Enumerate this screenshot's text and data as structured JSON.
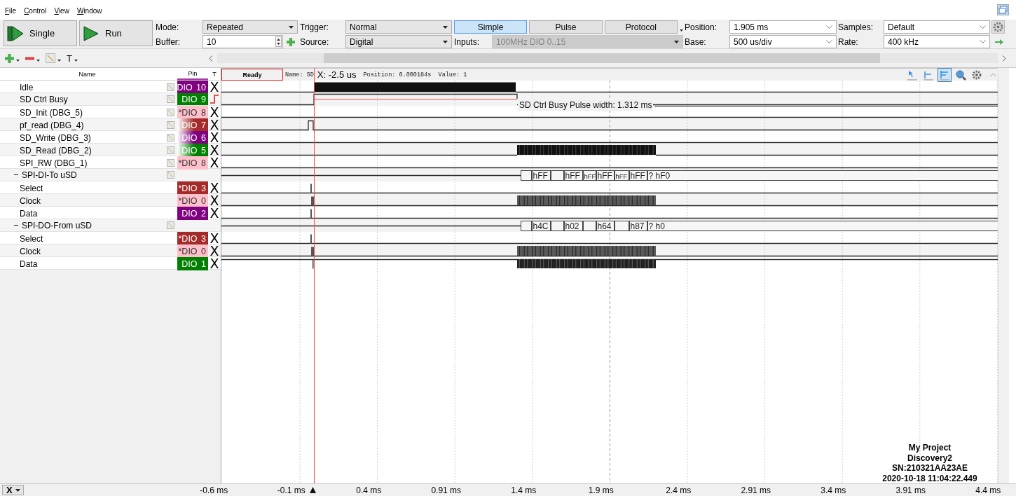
{
  "menu": [
    {
      "label": "File"
    },
    {
      "label": "Control"
    },
    {
      "label": "View"
    },
    {
      "label": "Window"
    }
  ],
  "toolbar": {
    "single": "Single",
    "run": "Run",
    "mode_label": "Mode:",
    "mode": "Repeated",
    "buffer_label": "Buffer:",
    "buffer": "10",
    "trigger_label": "Trigger:",
    "trigger": "Normal",
    "source_label": "Source:",
    "source": "Digital",
    "trigger_tabs": [
      {
        "label": "Simple",
        "selected": true
      },
      {
        "label": "Pulse",
        "selected": false
      },
      {
        "label": "Protocol",
        "selected": false
      }
    ],
    "inputs_label": "Inputs:",
    "inputs": {
      "value": "100MHz DIO 0..15",
      "disabled": true
    },
    "position_label": "Position:",
    "position": "1.905 ms",
    "base_label": "Base:",
    "base": "500 us/div",
    "samples_label": "Samples:",
    "samples": "Default",
    "rate_label": "Rate:",
    "rate": "400 kHz"
  },
  "edit_toolbar": {
    "text_tool": "T"
  },
  "list_header": {
    "name": "Name",
    "pin": "Pin",
    "trigger": "T"
  },
  "signals": [
    {
      "kind": "signal",
      "name": "Idle",
      "pin": {
        "label": "DIO 10",
        "color": "#800080",
        "faded": false
      },
      "trigger": {
        "kind": "ignore",
        "glyph": "X"
      }
    },
    {
      "kind": "signal",
      "name": "SD Ctrl Busy",
      "pin": {
        "label": "DIO 9",
        "color": "#008000",
        "faded": false
      },
      "trigger": {
        "kind": "rising"
      }
    },
    {
      "kind": "signal",
      "name": "SD_Init (DBG_5)",
      "pin": {
        "label": "*DIO 8",
        "color": "#ffc0cb",
        "faded": false
      },
      "trigger": {
        "kind": "ignore",
        "glyph": "X"
      }
    },
    {
      "kind": "signal",
      "name": "pf_read (DBG_4)",
      "pin": {
        "label": "DIO 7",
        "color": "#a52a2a",
        "faded": true
      },
      "trigger": {
        "kind": "ignore",
        "glyph": "X"
      }
    },
    {
      "kind": "signal",
      "name": "SD_Write (DBG_3)",
      "pin": {
        "label": "DIO 6",
        "color": "#800080",
        "faded": true
      },
      "trigger": {
        "kind": "ignore",
        "glyph": "X"
      }
    },
    {
      "kind": "signal",
      "name": "SD_Read (DBG_2)",
      "pin": {
        "label": "DIO 5",
        "color": "#008000",
        "faded": true
      },
      "trigger": {
        "kind": "ignore",
        "glyph": "X"
      }
    },
    {
      "kind": "signal",
      "name": "SPI_RW (DBG_1)",
      "pin": {
        "label": "*DIO 8",
        "color": "#ffc0cb",
        "faded": false
      },
      "trigger": {
        "kind": "ignore",
        "glyph": "X"
      }
    },
    {
      "kind": "bus",
      "name": "SPI-DI-To uSD",
      "expanded": true,
      "values": [
        "hFF",
        "hFF",
        "hFF",
        "hFF",
        "hFF",
        "hFF",
        "? hF0"
      ],
      "children": [
        {
          "name": "Select",
          "pin": {
            "label": "*DIO 3",
            "color": "#a52a2a",
            "faded": false
          },
          "trigger": {
            "kind": "ignore",
            "glyph": "X"
          }
        },
        {
          "name": "Clock",
          "pin": {
            "label": "*DIO 0",
            "color": "#ffc0cb",
            "faded": false
          },
          "trigger": {
            "kind": "ignore",
            "glyph": "X"
          }
        },
        {
          "name": "Data",
          "pin": {
            "label": "DIO 2",
            "color": "#800080",
            "faded": false
          },
          "trigger": {
            "kind": "ignore",
            "glyph": "X"
          }
        }
      ]
    },
    {
      "kind": "bus",
      "name": "SPI-DO-From uSD",
      "expanded": true,
      "values": [
        "h4C",
        "h02",
        "h64",
        "h87",
        "? h0"
      ],
      "children": [
        {
          "name": "Select",
          "pin": {
            "label": "*DIO 3",
            "color": "#a52a2a",
            "faded": false
          },
          "trigger": {
            "kind": "ignore",
            "glyph": "X"
          }
        },
        {
          "name": "Clock",
          "pin": {
            "label": "*DIO 0",
            "color": "#ffc0cb",
            "faded": false
          },
          "trigger": {
            "kind": "ignore",
            "glyph": "X"
          }
        },
        {
          "name": "Data",
          "pin": {
            "label": "DIO 1",
            "color": "#008000",
            "faded": false
          },
          "trigger": {
            "kind": "ignore",
            "glyph": "X"
          }
        }
      ]
    }
  ],
  "plot": {
    "status": "Ready",
    "name_readout": "Name: SD",
    "cursor_x": "X: -2.5 us",
    "readout": "Position: 0.000184s  Value: 1",
    "measurement": "SD Ctrl Busy Pulse width: 1.312 ms",
    "tools": [
      {
        "selected": false
      },
      {
        "selected": false
      },
      {
        "selected": true
      },
      {
        "selected": false
      },
      {
        "selected": false
      }
    ]
  },
  "device_info": [
    "My Project",
    "Discovery2",
    "SN:210321AA23AE",
    "2020-10-18 11:04:22.449"
  ],
  "time_axis": {
    "cursor_button": "X",
    "labels": [
      "-0.6 ms",
      "-0.1 ms",
      "0.4 ms",
      "0.91 ms",
      "1.4 ms",
      "1.9 ms",
      "2.4 ms",
      "2.91 ms",
      "3.4 ms",
      "3.91 ms",
      "4.4 ms"
    ]
  }
}
